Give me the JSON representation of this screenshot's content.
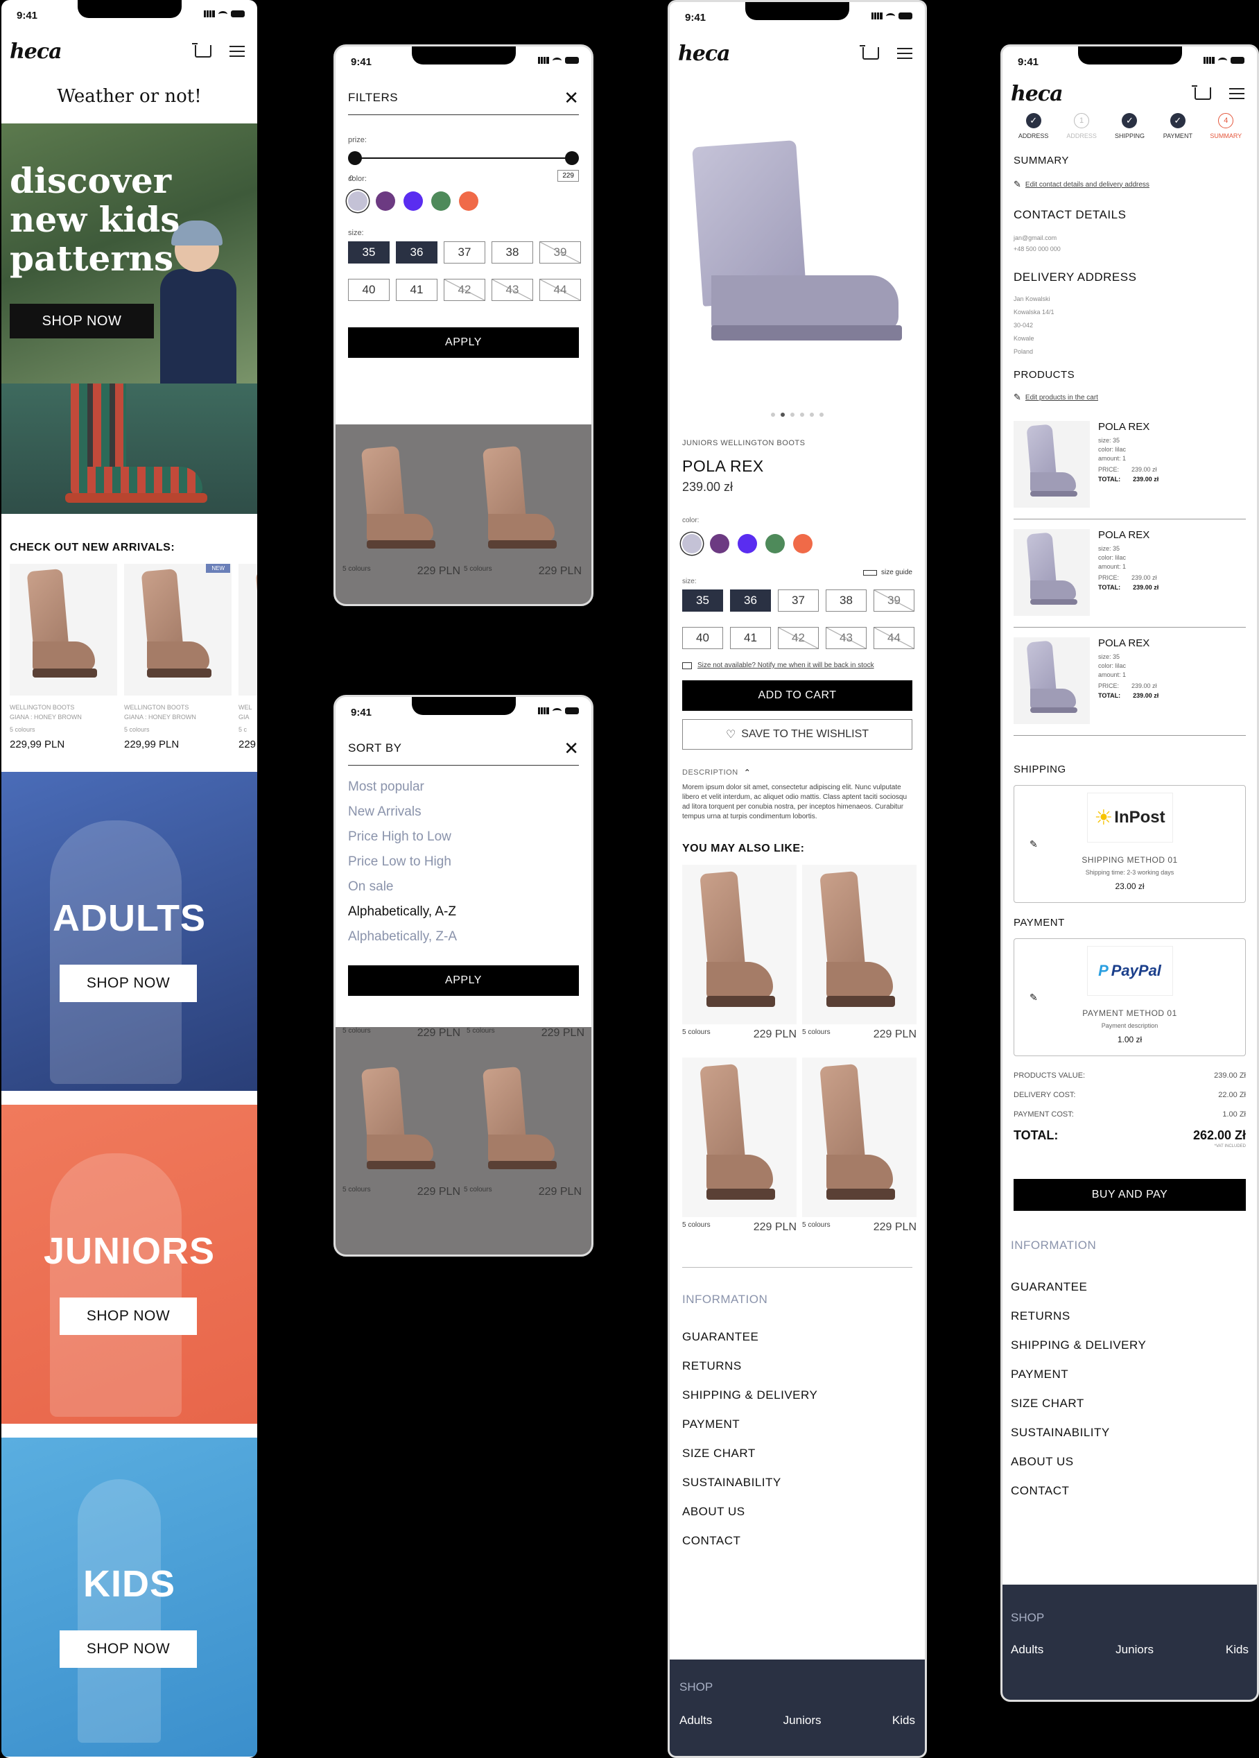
{
  "status": {
    "time": "9:41"
  },
  "brand": {
    "logo": "heca"
  },
  "home": {
    "title": "Weather or not!",
    "hero_text": "discover new kids patterns",
    "hero_button": "SHOP NOW",
    "arrivals_title": "CHECK OUT NEW ARRIVALS:",
    "new_badge": "NEW",
    "products": [
      {
        "line1": "WELLINGTON BOOTS",
        "line2": "GIANA : HONEY BROWN",
        "colours": "5 colours",
        "price": "229,99 PLN"
      },
      {
        "line1": "WELLINGTON BOOTS",
        "line2": "GIANA : HONEY BROWN",
        "colours": "5 colours",
        "price": "229,99 PLN"
      },
      {
        "line1": "WEL",
        "line2": "GIA",
        "colours": "5 c",
        "price": "229"
      }
    ],
    "banners": [
      {
        "label": "ADULTS",
        "button": "SHOP NOW"
      },
      {
        "label": "JUNIORS",
        "button": "SHOP NOW"
      },
      {
        "label": "KIDS",
        "button": "SHOP NOW"
      }
    ]
  },
  "filters": {
    "title": "FILTERS",
    "price_label": "prize:",
    "price_min": "0",
    "price_max": "229",
    "color_label": "color:",
    "colors": [
      "#c4c2d6",
      "#6c3a82",
      "#5a2df0",
      "#4e8a5a",
      "#f06a48"
    ],
    "size_label": "size:",
    "sizes": [
      {
        "v": "35",
        "state": "sel"
      },
      {
        "v": "36",
        "state": "sel"
      },
      {
        "v": "37",
        "state": "on"
      },
      {
        "v": "38",
        "state": "on"
      },
      {
        "v": "39",
        "state": "dis"
      },
      {
        "v": "40",
        "state": "on"
      },
      {
        "v": "41",
        "state": "on"
      },
      {
        "v": "42",
        "state": "dis"
      },
      {
        "v": "43",
        "state": "dis"
      },
      {
        "v": "44",
        "state": "dis"
      }
    ],
    "apply": "APPLY",
    "bg_colours": "5 colours",
    "bg_price": "229 PLN"
  },
  "sort": {
    "title": "SORT BY",
    "options": [
      "Most popular",
      "New Arrivals",
      "Price High to Low",
      "Price Low to High",
      "On sale",
      "Alphabetically, A-Z",
      "Alphabetically, Z-A"
    ],
    "selected": "Alphabetically, A-Z",
    "apply": "APPLY",
    "bg_colours": "5 colours",
    "bg_price": "229 PLN"
  },
  "product": {
    "category": "JUNIORS WELLINGTON BOOTS",
    "name": "POLA REX",
    "price": "239.00 zł",
    "color_label": "color:",
    "colors": [
      "#c4c2d6",
      "#6c3a82",
      "#5a2df0",
      "#4e8a5a",
      "#f06a48"
    ],
    "size_guide": "size guide",
    "size_label": "size:",
    "notify": "Size not available? Notify me when it will be back in stock",
    "add_to_cart": "ADD TO CART",
    "wishlist": "SAVE TO THE WISHLIST",
    "desc_label": "DESCRIPTION",
    "description": "Morem ipsum dolor sit amet, consectetur adipiscing elit. Nunc vulputate libero et velit interdum, ac aliquet odio mattis. Class aptent taciti sociosqu ad litora torquent per conubia nostra, per inceptos himenaeos. Curabitur tempus urna at turpis condimentum lobortis.",
    "also_like": "YOU MAY ALSO LIKE:",
    "also_colours": "5 colours",
    "also_price": "229 PLN",
    "image_dots": 6,
    "active_dot": 2
  },
  "checkout": {
    "steps": [
      {
        "label": "ADDRESS",
        "state": "done"
      },
      {
        "label": "ADDRESS",
        "state": "todo",
        "num": "1"
      },
      {
        "label": "SHIPPING",
        "state": "done"
      },
      {
        "label": "PAYMENT",
        "state": "done"
      },
      {
        "label": "SUMMARY",
        "state": "active",
        "num": "4"
      }
    ],
    "summary": "SUMMARY",
    "edit_contact": "Edit contact details and delivery address",
    "contact_title": "CONTACT DETAILS",
    "email": "jan@gmail.com",
    "phone": "+48 500 000 000",
    "address_title": "DELIVERY ADDRESS",
    "address": [
      "Jan Kowalski",
      "Kowalska 14/1",
      "30-042",
      "Kowale",
      "Poland"
    ],
    "products_title": "PRODUCTS",
    "edit_products": "Edit products in the cart",
    "items": [
      {
        "name": "POLA REX",
        "size": "size: 35",
        "color": "color: lilac",
        "amount": "amount: 1",
        "price_label": "PRICE:",
        "price": "239.00 zł",
        "total_label": "TOTAL:",
        "total": "239.00 zł"
      },
      {
        "name": "POLA REX",
        "size": "size: 35",
        "color": "color: lilac",
        "amount": "amount: 1",
        "price_label": "PRICE:",
        "price": "239.00 zł",
        "total_label": "TOTAL:",
        "total": "239.00 zł"
      },
      {
        "name": "POLA REX",
        "size": "size: 35",
        "color": "color: lilac",
        "amount": "amount: 1",
        "price_label": "PRICE:",
        "price": "239.00 zł",
        "total_label": "TOTAL:",
        "total": "239.00 zł"
      }
    ],
    "shipping_title": "SHIPPING",
    "shipping_logo": "InPost",
    "shipping_method": "SHIPPING METHOD 01",
    "shipping_time": "Shipping time: 2-3 working days",
    "shipping_price": "23.00 zł",
    "payment_title": "PAYMENT",
    "payment_logo": "PayPal",
    "payment_method": "PAYMENT METHOD 01",
    "payment_desc": "Payment description",
    "payment_price": "1.00 zł",
    "products_value_label": "PRODUCTS VALUE:",
    "products_value": "239.00 Zł",
    "delivery_label": "DELIVERY COST:",
    "delivery": "22.00 Zł",
    "payment_cost_label": "PAYMENT COST:",
    "payment_cost": "1.00 Zł",
    "total_label": "TOTAL:",
    "total": "262.00 Zł",
    "vat": "*VAT INCLUDED",
    "buy": "BUY AND PAY"
  },
  "footer": {
    "info_title": "INFORMATION",
    "links": [
      "GUARANTEE",
      "RETURNS",
      "SHIPPING & DELIVERY",
      "PAYMENT",
      "SIZE CHART",
      "SUSTAINABILITY",
      "ABOUT US",
      "CONTACT"
    ],
    "shop_title": "SHOP",
    "shop_links": [
      "Adults",
      "Juniors",
      "Kids"
    ]
  }
}
